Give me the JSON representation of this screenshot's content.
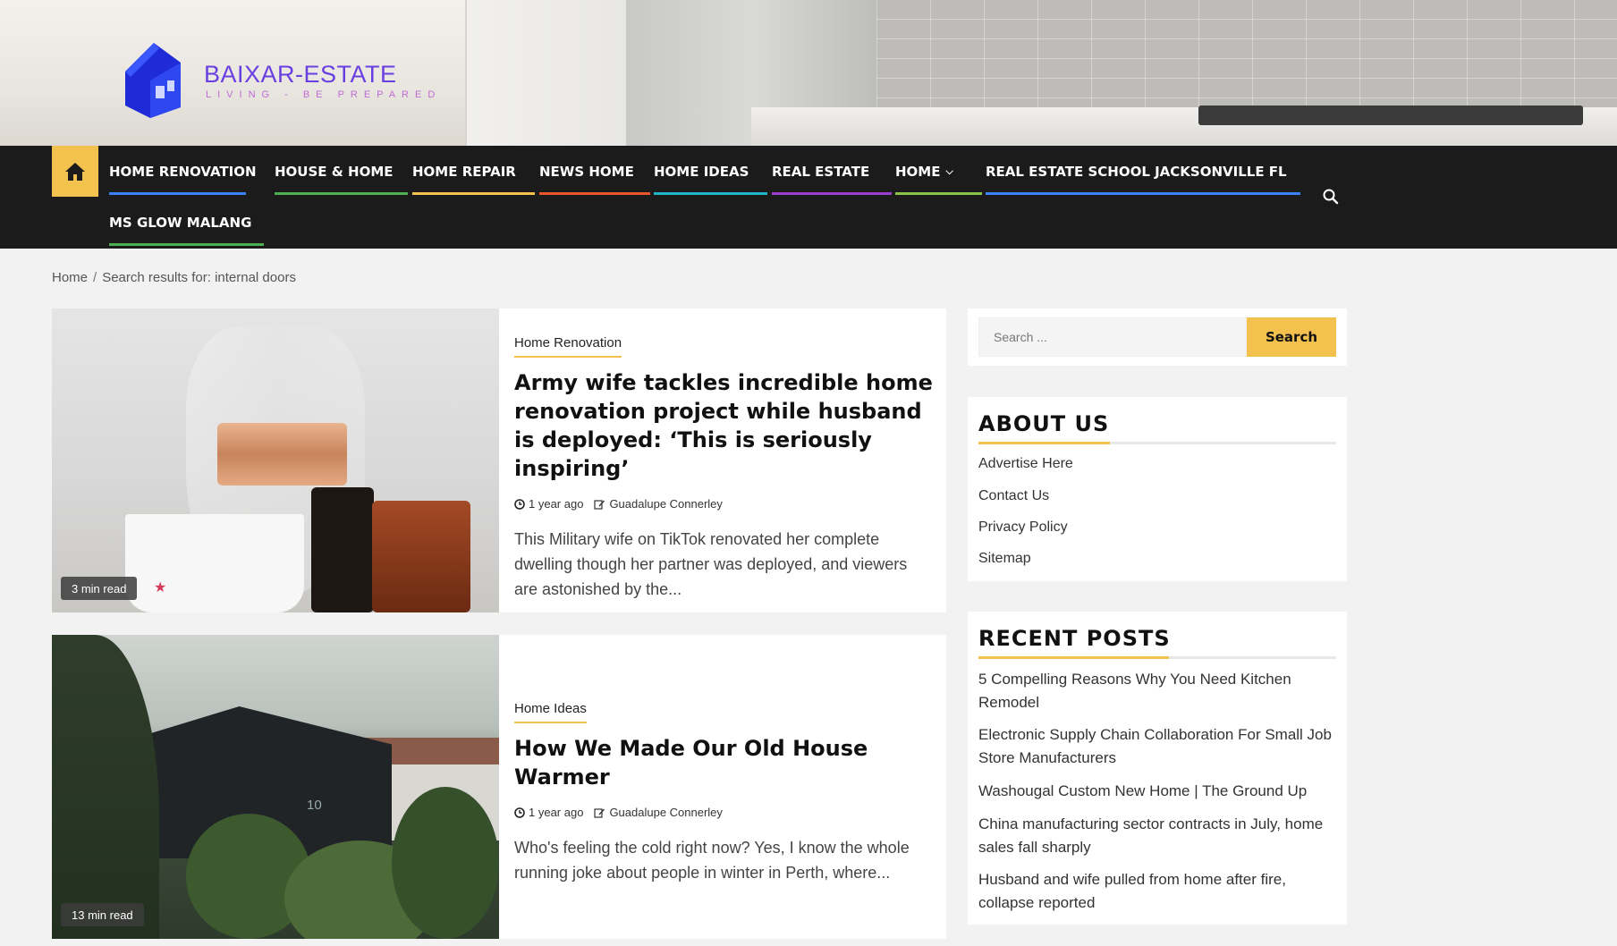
{
  "site": {
    "name": "BAIXAR-ESTATE",
    "tagline": "LIVING - BE PREPARED"
  },
  "nav": {
    "items": [
      {
        "label": "HOME RENOVATION",
        "color": "#3b82f6"
      },
      {
        "label": "HOUSE & HOME",
        "color": "#4caf50"
      },
      {
        "label": "HOME REPAIR",
        "color": "#f2c14e"
      },
      {
        "label": "NEWS HOME",
        "color": "#e8562a"
      },
      {
        "label": "HOME IDEAS",
        "color": "#22b5c9"
      },
      {
        "label": "REAL ESTATE",
        "color": "#9c3fd0"
      },
      {
        "label": "HOME",
        "color": "#8bc34a"
      },
      {
        "label": "REAL ESTATE SCHOOL JACKSONVILLE FL",
        "color": "#3b82f6"
      },
      {
        "label": "MS GLOW MALANG",
        "color": "#4caf50"
      }
    ]
  },
  "breadcrumb": {
    "home": "Home",
    "separator": "/",
    "current": "Search results for: internal doors"
  },
  "posts": [
    {
      "category": "Home Renovation",
      "title": "Army wife tackles incredible home renovation project while husband is deployed: ‘This is seriously inspiring’",
      "time": "1 year ago",
      "author": "Guadalupe Connerley",
      "excerpt": "This Military wife on TikTok renovated her complete dwelling though her partner was deployed, and viewers are astonished by the...",
      "read_time": "3 min read"
    },
    {
      "category": "Home Ideas",
      "title": "How We Made Our Old House Warmer",
      "time": "1 year ago",
      "author": "Guadalupe Connerley",
      "excerpt": "Who's feeling the cold right now? Yes, I know the whole running joke about people in winter in Perth, where...",
      "read_time": "13 min read"
    }
  ],
  "sidebar": {
    "search": {
      "placeholder": "Search ...",
      "button": "Search"
    },
    "about": {
      "title": "ABOUT US",
      "links": [
        "Advertise Here",
        "Contact Us",
        "Privacy Policy",
        "Sitemap"
      ]
    },
    "recent": {
      "title": "RECENT POSTS",
      "links": [
        "5 Compelling Reasons Why You Need Kitchen Remodel",
        "Electronic Supply Chain Collaboration For Small Job Store Manufacturers",
        "Washougal Custom New Home | The Ground Up",
        "China manufacturing sector contracts in July, home sales fall sharply",
        "Husband and wife pulled from home after fire, collapse reported"
      ]
    }
  },
  "colors": {
    "accent": "#f2c14e",
    "nav_bg": "#1b1b1b",
    "logo": "#6a3fe0"
  }
}
